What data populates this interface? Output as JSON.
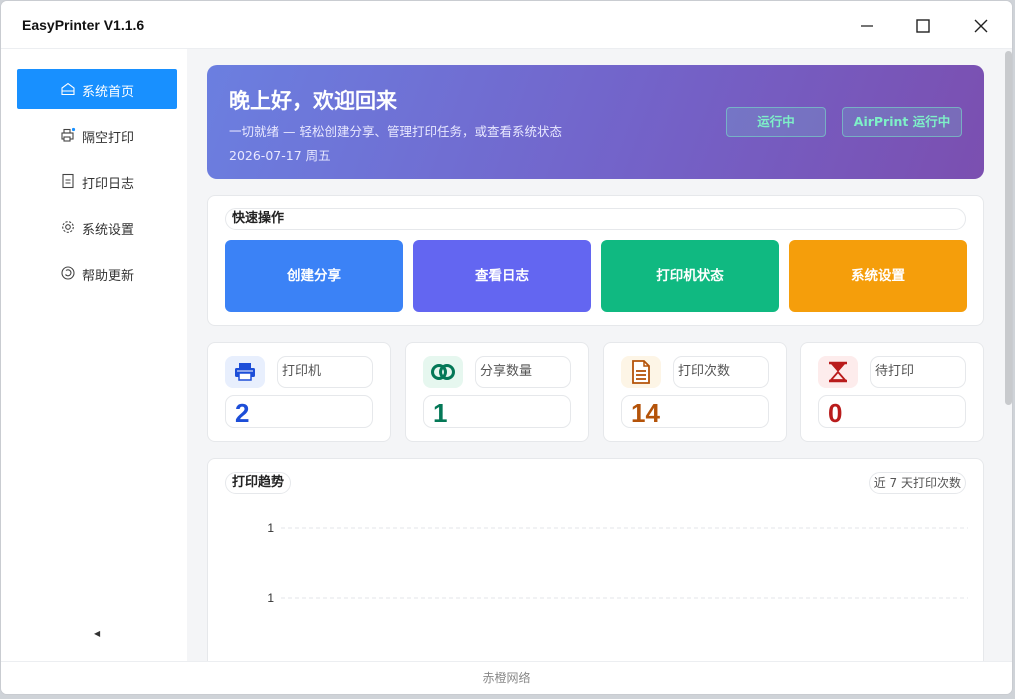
{
  "window": {
    "title": "EasyPrinter  V1.1.6"
  },
  "sidebar": {
    "items": [
      {
        "label": "系统首页",
        "icon": "home-icon",
        "active": true
      },
      {
        "label": "隔空打印",
        "icon": "airprint-icon",
        "active": false
      },
      {
        "label": "打印日志",
        "icon": "document-icon",
        "active": false
      },
      {
        "label": "系统设置",
        "icon": "gear-icon",
        "active": false
      },
      {
        "label": "帮助更新",
        "icon": "refresh-icon",
        "active": false
      }
    ]
  },
  "banner": {
    "greeting": "晚上好，欢迎回来",
    "subtitle": "一切就绪 — 轻松创建分享、管理打印任务，或查看系统状态",
    "date": "2026-07-17 周五",
    "status_running": "运行中",
    "status_airprint": "AirPrint 运行中"
  },
  "quick": {
    "title": "快速操作",
    "buttons": [
      {
        "label": "创建分享",
        "color": "#3b82f6"
      },
      {
        "label": "查看日志",
        "color": "#6366f1"
      },
      {
        "label": "打印机状态",
        "color": "#10b981"
      },
      {
        "label": "系统设置",
        "color": "#f59e0b"
      }
    ]
  },
  "stats": [
    {
      "label": "打印机",
      "value": "2",
      "icon": "printer-icon",
      "color": "#1d4ed8"
    },
    {
      "label": "分享数量",
      "value": "1",
      "icon": "link-icon",
      "color": "#047857"
    },
    {
      "label": "打印次数",
      "value": "14",
      "icon": "file-text-icon",
      "color": "#b45309"
    },
    {
      "label": "待打印",
      "value": "0",
      "icon": "hourglass-icon",
      "color": "#b91c1c"
    }
  ],
  "trend": {
    "title": "打印趋势",
    "range_label": "近 7 天打印次数",
    "chart_data": {
      "type": "line",
      "y_ticks": [
        "1",
        "1"
      ],
      "grid": true
    }
  },
  "footer": {
    "text": "赤橙网络"
  },
  "colors": {
    "accent": "#1890ff"
  }
}
